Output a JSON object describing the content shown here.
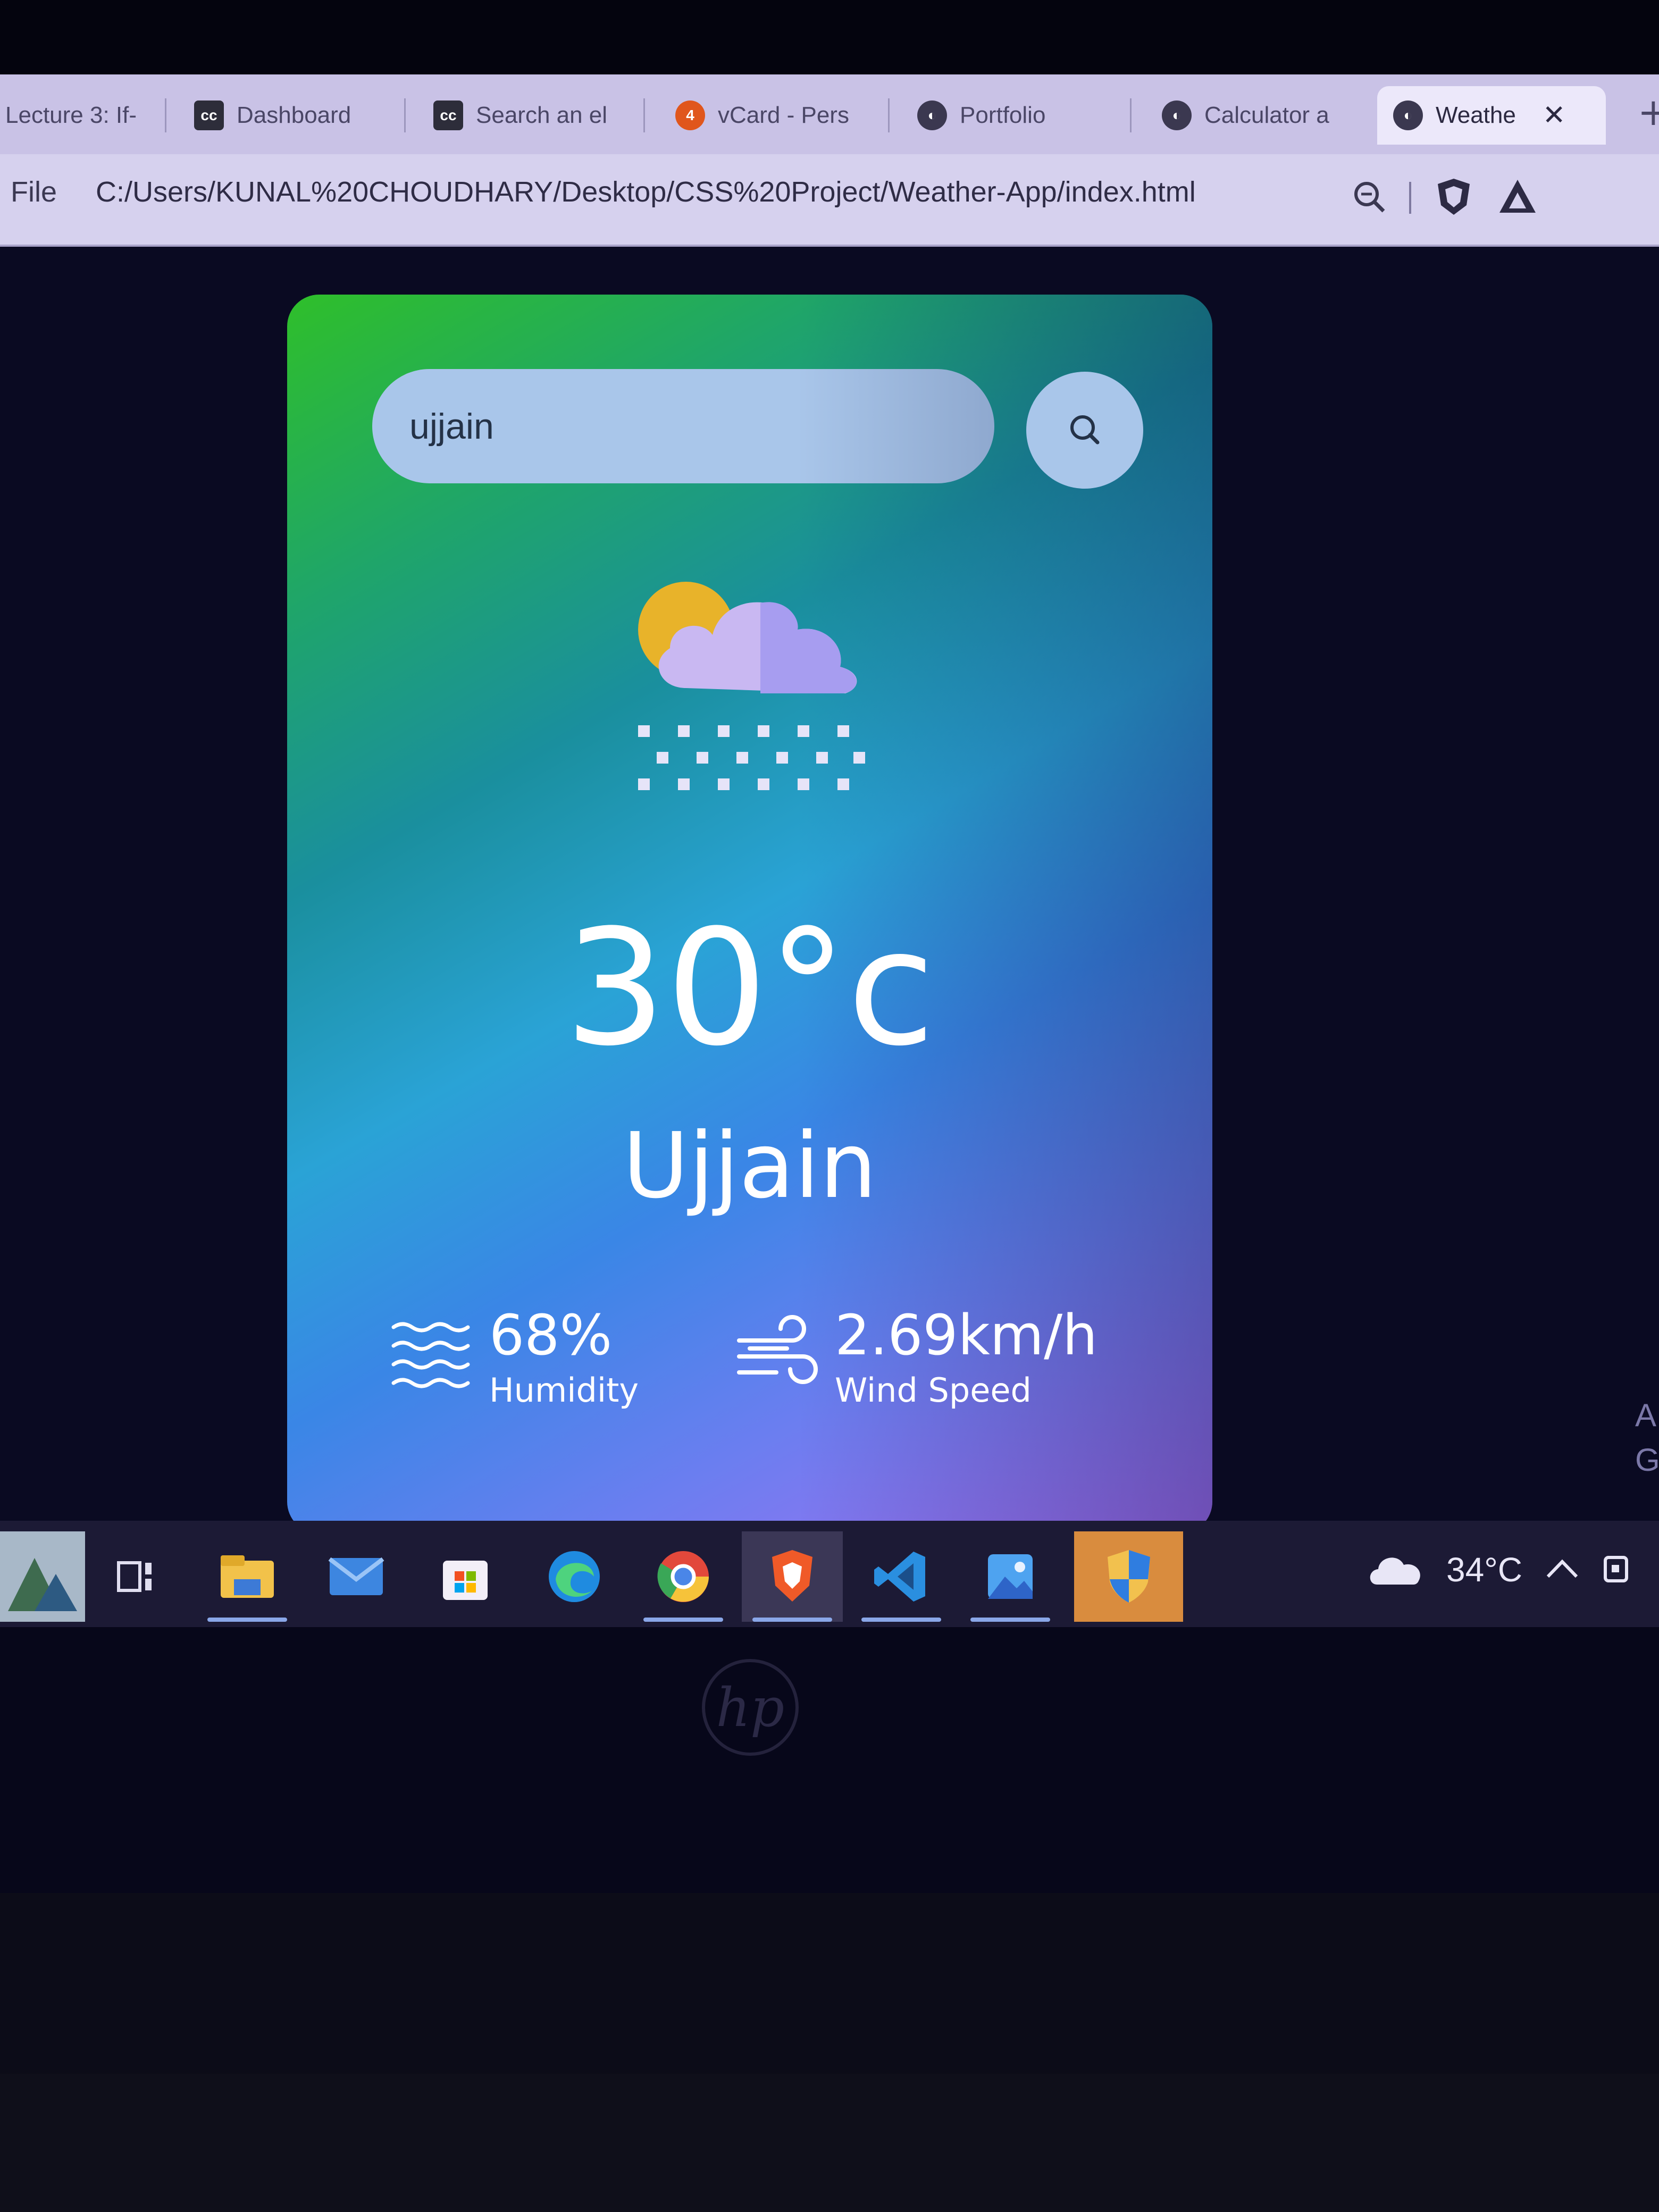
{
  "browser": {
    "tabs": [
      {
        "label": "Lecture 3: If-",
        "favicon": "page-icon"
      },
      {
        "label": "Dashboard",
        "favicon": "cc-icon"
      },
      {
        "label": "Search an el",
        "favicon": "cc-icon"
      },
      {
        "label": "vCard - Pers",
        "favicon": "vcard-icon"
      },
      {
        "label": "Portfolio",
        "favicon": "globe-icon"
      },
      {
        "label": "Calculator a",
        "favicon": "globe-icon"
      },
      {
        "label": "Weathe",
        "favicon": "globe-icon",
        "active": true
      }
    ],
    "close_symbol": "✕",
    "new_tab_symbol": "+",
    "address": {
      "scheme_label": "File",
      "url": "C:/Users/KUNAL%20CHOUDHARY/Desktop/CSS%20Project/Weather-App/index.html"
    }
  },
  "weather": {
    "search": {
      "value": "ujjain"
    },
    "icon": "sun-cloud-snow-icon",
    "temperature": "30°c",
    "city": "Ujjain",
    "humidity": {
      "value": "68%",
      "label": "Humidity",
      "icon": "humidity-waves-icon"
    },
    "wind": {
      "value": "2.69km/h",
      "label": "Wind Speed",
      "icon": "wind-icon"
    }
  },
  "taskbar": {
    "apps": [
      "widgets-icon",
      "task-view-icon",
      "file-explorer-icon",
      "mail-icon",
      "store-icon",
      "edge-icon",
      "chrome-icon",
      "brave-icon",
      "vscode-icon",
      "photos-icon",
      "security-shield-icon"
    ],
    "tray": {
      "weather_icon": "cloud-icon",
      "temperature": "34°C"
    }
  },
  "desktop_side_text": [
    "A",
    "G"
  ],
  "colors": {
    "card_gradient": [
      "#2fbf2a",
      "#2aa3d6",
      "#6b7ef0",
      "#a86ef2"
    ],
    "search_bg": "#a9c6ea",
    "taskbar_bg": "#1c1a35"
  }
}
